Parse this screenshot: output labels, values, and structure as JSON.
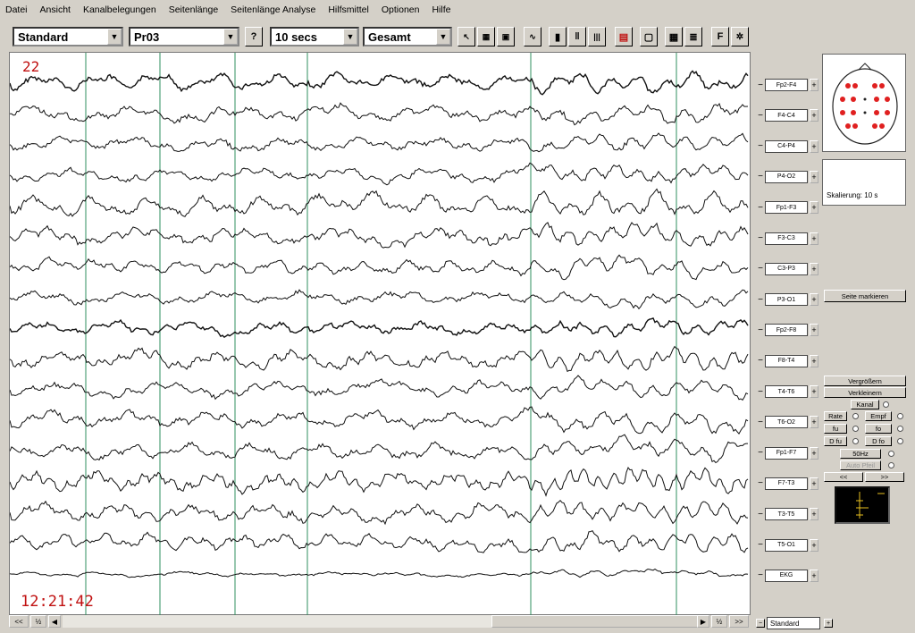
{
  "menu": [
    "Datei",
    "Ansicht",
    "Kanalbelegungen",
    "Seitenlänge",
    "Seitenlänge Analyse",
    "Hilfsmittel",
    "Optionen",
    "Hilfe"
  ],
  "toolbar": {
    "montage": "Standard",
    "patient": "Pr03",
    "help": "?",
    "timebase": "10 secs",
    "view": "Gesamt",
    "filter_button": "F"
  },
  "plot": {
    "page_number": "22",
    "time": "12:21:42"
  },
  "channels": [
    "Fp2-F4",
    "F4-C4",
    "C4-P4",
    "P4-O2",
    "Fp1-F3",
    "F3-C3",
    "C3-P3",
    "P3-O1",
    "Fp2-F8",
    "F8-T4",
    "T4-T6",
    "T6-O2",
    "Fp1-F7",
    "F7-T3",
    "T3-T5",
    "T5-O1",
    "EKG"
  ],
  "side": {
    "scale_label": "Skalierung: 10 s",
    "mark_page": "Seite markieren",
    "zoom_in": "Vergrößern",
    "zoom_out": "Verkleinern",
    "channel": "Kanal",
    "rate": "Rate",
    "empf": "Empf",
    "fu": "fu",
    "fo": "fo",
    "d_fu": "D fu",
    "d_fo": "D fo",
    "hz50": "50Hz",
    "auto_pfeil": "Auto Pfeil",
    "prev": "<<",
    "next": ">>"
  },
  "scrollbar": {
    "first": "<<",
    "half_left": "½",
    "left": "◀",
    "right": "▶",
    "half_right": "½",
    "last": ">>"
  },
  "footer_montage": "Standard",
  "colors": {
    "trace": "#111111",
    "gridline": "#2f8f5f",
    "annotation": "#c01010",
    "electrode": "#e02020"
  }
}
